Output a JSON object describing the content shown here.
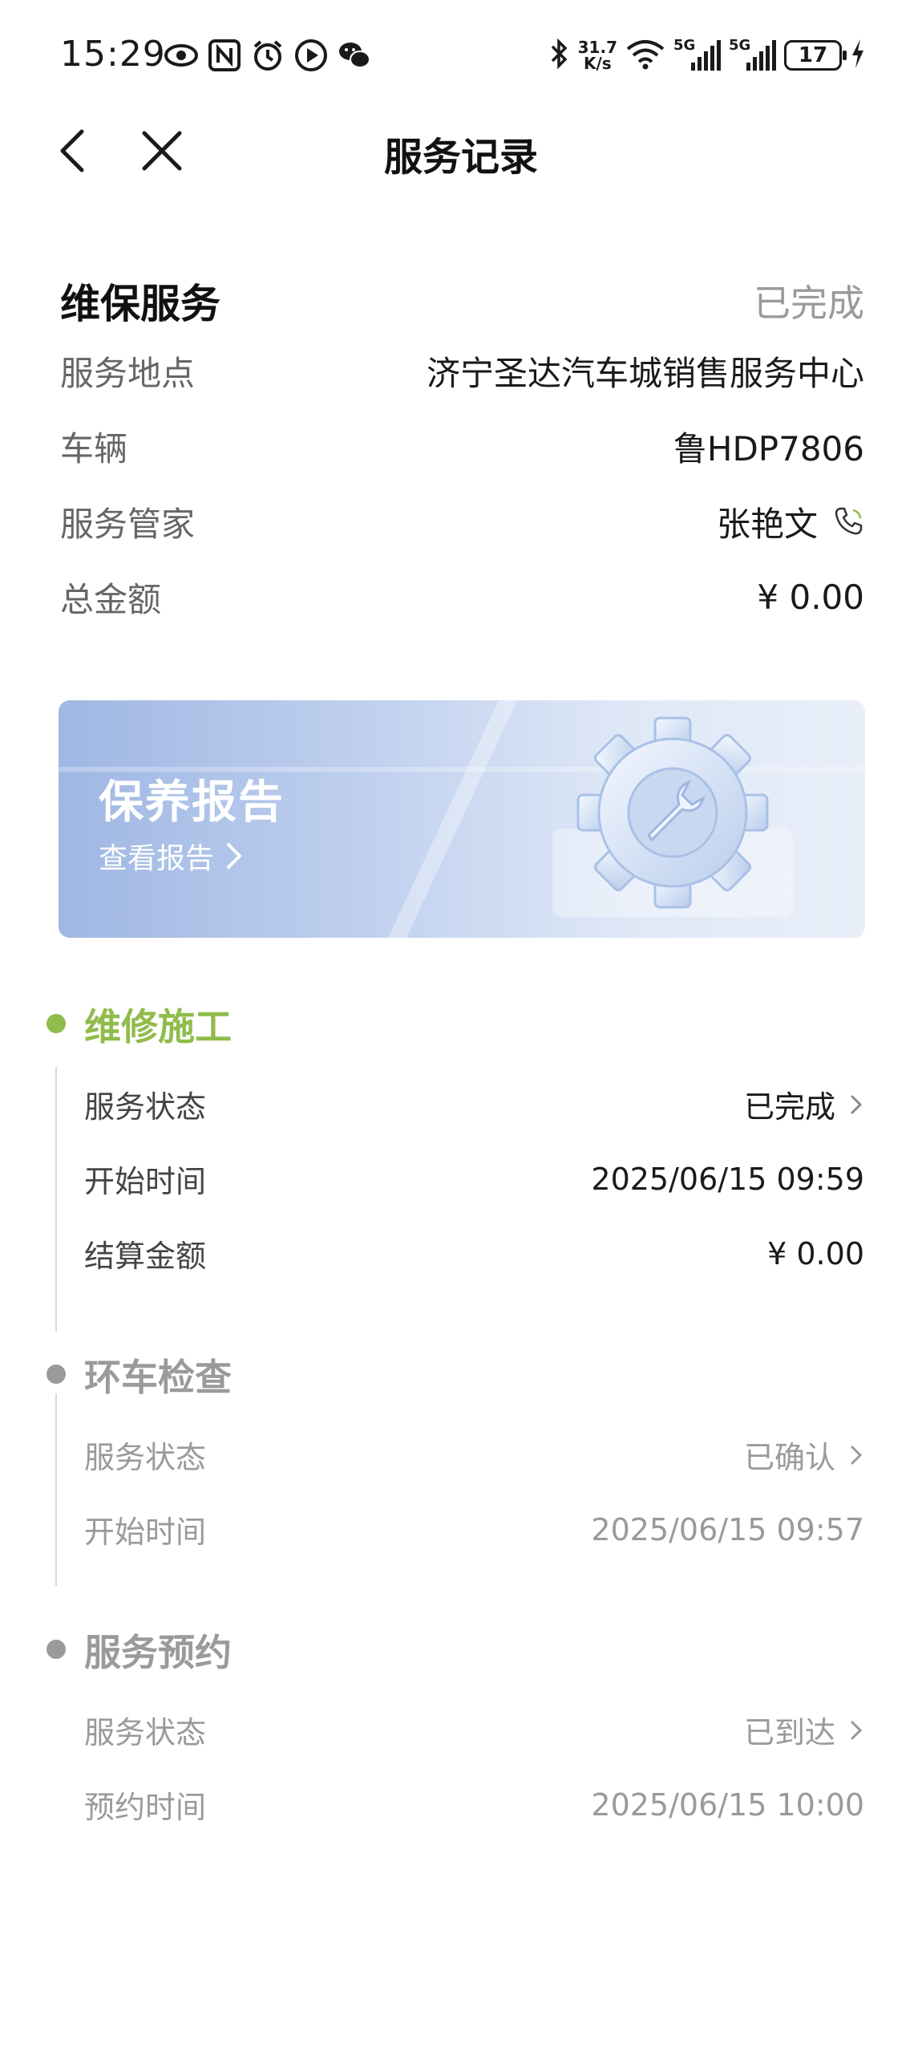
{
  "status_bar": {
    "time": "15:29",
    "net_speed_value": "31.7",
    "net_speed_unit": "K/s",
    "signal_label_1": "5G",
    "signal_label_2": "5G",
    "battery": "17"
  },
  "header": {
    "title": "服务记录"
  },
  "summary": {
    "title": "维保服务",
    "status": "已完成",
    "rows": [
      {
        "label": "服务地点",
        "value": "济宁圣达汽车城销售服务中心"
      },
      {
        "label": "车辆",
        "value": "鲁HDP7806"
      },
      {
        "label": "服务管家",
        "value": "张艳文"
      },
      {
        "label": "总金额",
        "value": "¥ 0.00"
      }
    ]
  },
  "banner": {
    "title": "保养报告",
    "link": "查看报告"
  },
  "timeline": [
    {
      "title": "维修施工",
      "rows": [
        {
          "label": "服务状态",
          "value": "已完成"
        },
        {
          "label": "开始时间",
          "value": "2025/06/15 09:59"
        },
        {
          "label": "结算金额",
          "value": "¥  0.00"
        }
      ]
    },
    {
      "title": "环车检查",
      "rows": [
        {
          "label": "服务状态",
          "value": "已确认"
        },
        {
          "label": "开始时间",
          "value": "2025/06/15 09:57"
        }
      ]
    },
    {
      "title": "服务预约",
      "rows": [
        {
          "label": "服务状态",
          "value": "已到达"
        },
        {
          "label": "预约时间",
          "value": "2025/06/15 10:00"
        }
      ]
    }
  ],
  "colors": {
    "accent": "#8fbc4a",
    "muted": "#9a9a9a"
  }
}
